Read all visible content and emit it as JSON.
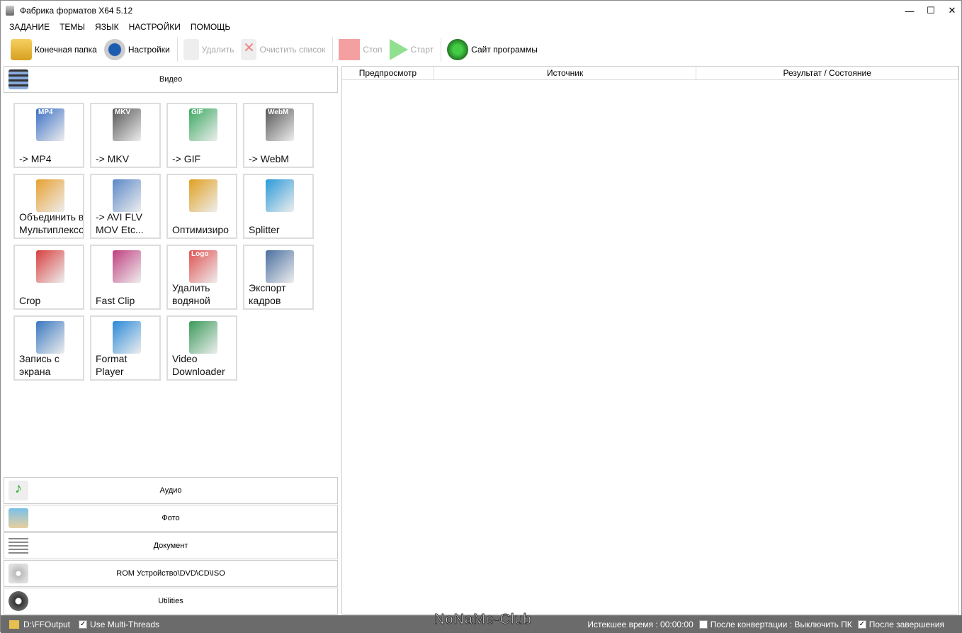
{
  "window": {
    "title": "Фабрика форматов X64 5.12",
    "minimize": "—",
    "maximize": "☐",
    "close": "✕"
  },
  "menu": [
    "ЗАДАНИЕ",
    "ТЕМЫ",
    "ЯЗЫК",
    "НАСТРОЙКИ",
    "ПОМОЩЬ"
  ],
  "toolbar": {
    "output_folder": "Конечная папка",
    "settings": "Настройки",
    "delete": "Удалить",
    "clear_list": "Очистить список",
    "stop": "Стоп",
    "start": "Старт",
    "website": "Сайт программы"
  },
  "categories": {
    "video": "Видео",
    "audio": "Аудио",
    "photo": "Фото",
    "document": "Документ",
    "rom": "ROM Устройство\\DVD\\CD\\ISO",
    "utilities": "Utilities"
  },
  "tiles": [
    {
      "label": "-> MP4",
      "badge": "MP4",
      "color": "#3a6fc4"
    },
    {
      "label": "-> MKV",
      "badge": "MKV",
      "color": "#555"
    },
    {
      "label": "-> GIF",
      "badge": "GIF",
      "color": "#3aa860"
    },
    {
      "label": "-> WebM",
      "badge": "WebM",
      "color": "#555"
    },
    {
      "label": "Объединить видео &\nМультиплексор",
      "color": "#e8a030"
    },
    {
      "label": "-> AVI FLV\nMOV Etc...",
      "color": "#5b88c8"
    },
    {
      "label": "Оптимизиро",
      "color": "#e0a020"
    },
    {
      "label": "Splitter",
      "color": "#2a9ad8"
    },
    {
      "label": "Crop",
      "color": "#d84040"
    },
    {
      "label": "Fast Clip",
      "color": "#c04080"
    },
    {
      "label": "Удалить\nводяной",
      "badge": "Logo",
      "color": "#e05050"
    },
    {
      "label": "Экспорт\nкадров",
      "color": "#4a6fa0"
    },
    {
      "label": "Запись с\nэкрана",
      "color": "#3a78c0"
    },
    {
      "label": "Format\nPlayer",
      "color": "#2a8ad8"
    },
    {
      "label": "Video\nDownloader",
      "color": "#3a9a5a"
    }
  ],
  "table": {
    "columns": [
      "Предпросмотр",
      "Источник",
      "Результат / Состояние"
    ]
  },
  "status": {
    "folder": "D:\\FFOutput",
    "multithreads": "Use Multi-Threads",
    "elapsed": "Истекшее время : 00:00:00",
    "after_convert": "После конвертации : Выключить ПК",
    "after_finish": "После завершения",
    "check": "✓"
  },
  "watermark": "NoNaMe-Club"
}
